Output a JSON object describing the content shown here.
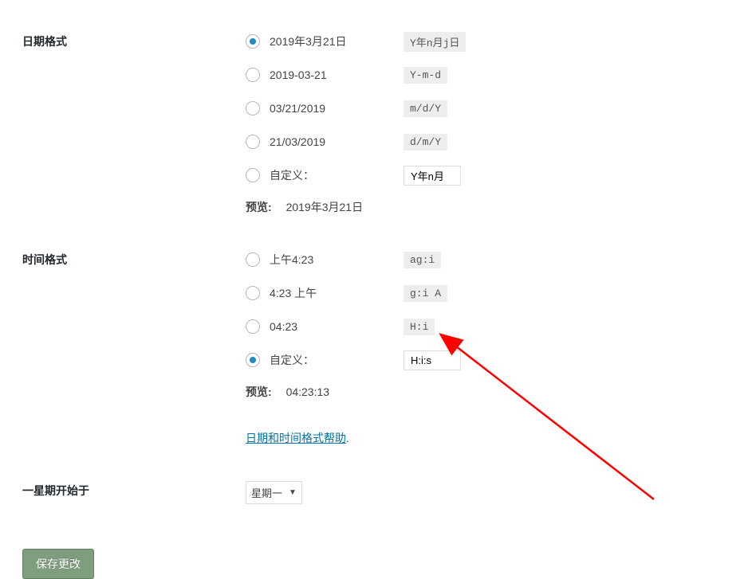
{
  "date_section": {
    "heading": "日期格式",
    "options": [
      {
        "label": "2019年3月21日",
        "code": "Y年n月j日",
        "checked": true
      },
      {
        "label": "2019-03-21",
        "code": "Y-m-d",
        "checked": false
      },
      {
        "label": "03/21/2019",
        "code": "m/d/Y",
        "checked": false
      },
      {
        "label": "21/03/2019",
        "code": "d/m/Y",
        "checked": false
      }
    ],
    "custom_label": "自定义：",
    "custom_value": "Y年n月",
    "preview_label": "预览:",
    "preview_value": "2019年3月21日"
  },
  "time_section": {
    "heading": "时间格式",
    "options": [
      {
        "label": "上午4:23",
        "code": "ag:i",
        "checked": false
      },
      {
        "label": "4:23 上午",
        "code": "g:i A",
        "checked": false
      },
      {
        "label": "04:23",
        "code": "H:i",
        "checked": false
      }
    ],
    "custom_label": "自定义：",
    "custom_value": "H:i:s",
    "custom_checked": true,
    "preview_label": "预览:",
    "preview_value": "04:23:13",
    "help_link": "日期和时间格式帮助",
    "help_dot": "."
  },
  "week_section": {
    "heading": "一星期开始于",
    "selected": "星期一"
  },
  "save_button": "保存更改"
}
